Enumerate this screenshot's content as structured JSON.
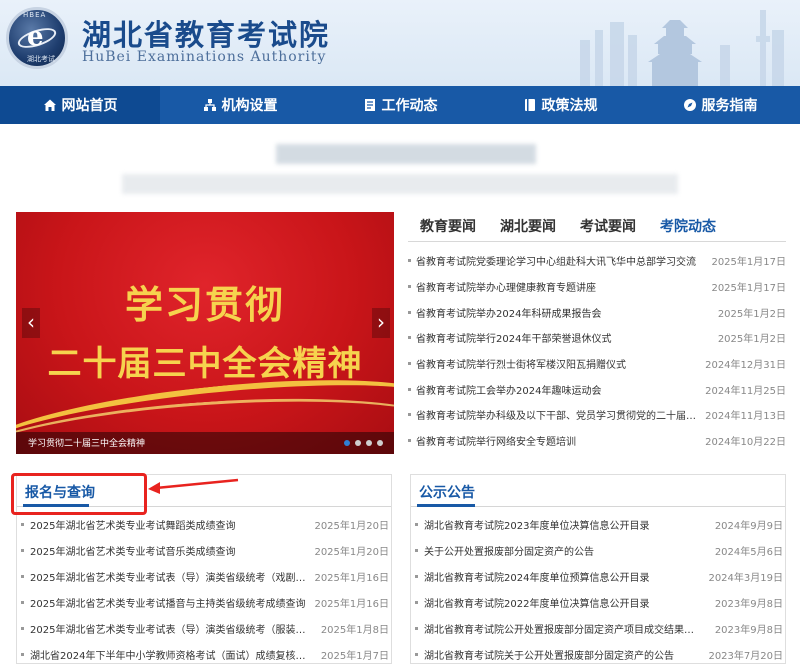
{
  "header": {
    "logo_top_text": "HBEA",
    "logo_bottom_text": "湖北考试",
    "title": "湖北省教育考试院",
    "subtitle": "HuBei Examinations Authority"
  },
  "nav": [
    {
      "label": "网站首页",
      "icon": "home-icon"
    },
    {
      "label": "机构设置",
      "icon": "org-chart-icon"
    },
    {
      "label": "工作动态",
      "icon": "document-icon"
    },
    {
      "label": "政策法规",
      "icon": "book-icon"
    },
    {
      "label": "服务指南",
      "icon": "compass-icon"
    }
  ],
  "slider": {
    "line1": "学习贯彻",
    "line2": "二十届三中全会精神",
    "caption": "学习贯彻二十届三中全会精神",
    "prev": "‹",
    "next": "›"
  },
  "news": {
    "tabs": [
      "教育要闻",
      "湖北要闻",
      "考试要闻",
      "考院动态"
    ],
    "active_tab": "考院动态",
    "items": [
      {
        "title": "省教育考试院党委理论学习中心组赴科大讯飞华中总部学习交流",
        "date": "2025年1月17日"
      },
      {
        "title": "省教育考试院举办心理健康教育专题讲座",
        "date": "2025年1月17日"
      },
      {
        "title": "省教育考试院举办2024年科研成果报告会",
        "date": "2025年1月2日"
      },
      {
        "title": "省教育考试院举行2024年干部荣誉退休仪式",
        "date": "2025年1月2日"
      },
      {
        "title": "省教育考试院举行烈士街将军楼汉阳瓦捐赠仪式",
        "date": "2024年12月31日"
      },
      {
        "title": "省教育考试院工会举办2024年趣味运动会",
        "date": "2024年11月25日"
      },
      {
        "title": "省教育考试院举办科级及以下干部、党员学习贯彻党的二十届…",
        "date": "2024年11月13日"
      },
      {
        "title": "省教育考试院举行网络安全专题培训",
        "date": "2024年10月22日"
      }
    ]
  },
  "registration": {
    "title": "报名与查询",
    "items": [
      {
        "title": "2025年湖北省艺术类专业考试舞蹈类成绩查询",
        "date": "2025年1月20日"
      },
      {
        "title": "2025年湖北省艺术类专业考试音乐类成绩查询",
        "date": "2025年1月20日"
      },
      {
        "title": "2025年湖北省艺术类专业考试表（导）演类省级统考（戏剧…",
        "date": "2025年1月16日"
      },
      {
        "title": "2025年湖北省艺术类专业考试播音与主持类省级统考成绩查询",
        "date": "2025年1月16日"
      },
      {
        "title": "2025年湖北省艺术类专业考试表（导）演类省级统考（服装…",
        "date": "2025年1月8日"
      },
      {
        "title": "湖北省2024年下半年中小学教师资格考试（面试）成绩复核…",
        "date": "2025年1月7日"
      }
    ]
  },
  "announcements": {
    "title": "公示公告",
    "items": [
      {
        "title": "湖北省教育考试院2023年度单位决算信息公开目录",
        "date": "2024年9月9日"
      },
      {
        "title": "关于公开处置报废部分固定资产的公告",
        "date": "2024年5月6日"
      },
      {
        "title": "湖北省教育考试院2024年度单位预算信息公开目录",
        "date": "2024年3月19日"
      },
      {
        "title": "湖北省教育考试院2022年度单位决算信息公开目录",
        "date": "2023年9月8日"
      },
      {
        "title": "湖北省教育考试院公开处置报废部分固定资产项目成交结果…",
        "date": "2023年9月8日"
      },
      {
        "title": "湖北省教育考试院关于公开处置报废部分固定资产的公告",
        "date": "2023年7月20日"
      }
    ]
  },
  "colors": {
    "nav_bg": "#1859a6",
    "brand_blue": "#1a4b8c",
    "highlight_red": "#e8231f",
    "slide_red": "#c91519",
    "slide_gold": "#f6d34e"
  }
}
